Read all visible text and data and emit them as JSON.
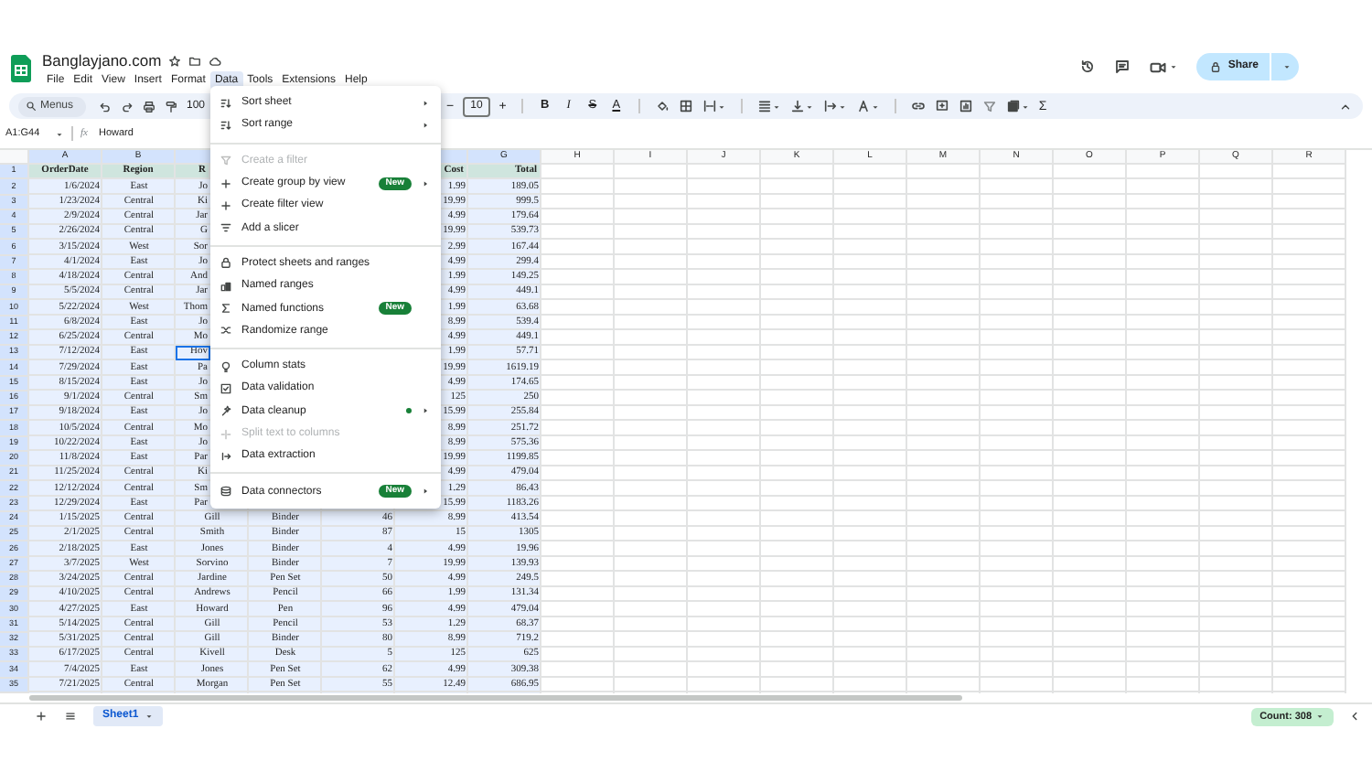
{
  "document": {
    "title": "Banglayjano.com"
  },
  "menubar": [
    {
      "label": "File",
      "selected": false
    },
    {
      "label": "Edit",
      "selected": false
    },
    {
      "label": "View",
      "selected": false
    },
    {
      "label": "Insert",
      "selected": false
    },
    {
      "label": "Format",
      "selected": false
    },
    {
      "label": "Data",
      "selected": true
    },
    {
      "label": "Tools",
      "selected": false
    },
    {
      "label": "Extensions",
      "selected": false
    },
    {
      "label": "Help",
      "selected": false
    }
  ],
  "share_button": {
    "label": "Share"
  },
  "toolbar": {
    "search_placeholder": "Menus",
    "zoom": "100",
    "font_size_minus": "−",
    "font_size": "10",
    "font_size_plus": "+",
    "style_buttons": [
      "B",
      "I",
      "S",
      "A"
    ],
    "sum": "Σ"
  },
  "formula_bar": {
    "name_box": "A1:G44",
    "fx": "fx",
    "value": "Howard"
  },
  "columns_left": [
    "A",
    "B"
  ],
  "columns_right": [
    "G",
    "H",
    "I",
    "J",
    "K",
    "L",
    "M",
    "N",
    "O",
    "P",
    "Q",
    "R"
  ],
  "rows": [
    {
      "number": "1",
      "kind": "header",
      "active": false,
      "order_date": "OrderDate",
      "region": "Region",
      "rep": "R",
      "cost": "Cost",
      "total": "Total"
    },
    {
      "number": "2",
      "kind": "data",
      "active": false,
      "order_date": "1/6/2024",
      "region": "East",
      "rep": "Jo",
      "cost": "1.99",
      "total": "189.05"
    },
    {
      "number": "3",
      "kind": "data",
      "active": false,
      "order_date": "1/23/2024",
      "region": "Central",
      "rep": "Ki",
      "cost": "19.99",
      "total": "999.5"
    },
    {
      "number": "4",
      "kind": "data",
      "active": false,
      "order_date": "2/9/2024",
      "region": "Central",
      "rep": "Jar",
      "cost": "4.99",
      "total": "179.64"
    },
    {
      "number": "5",
      "kind": "data",
      "active": false,
      "order_date": "2/26/2024",
      "region": "Central",
      "rep": "G",
      "cost": "19.99",
      "total": "539.73"
    },
    {
      "number": "6",
      "kind": "data",
      "active": false,
      "order_date": "3/15/2024",
      "region": "West",
      "rep": "Sor",
      "cost": "2.99",
      "total": "167.44"
    },
    {
      "number": "7",
      "kind": "data",
      "active": false,
      "order_date": "4/1/2024",
      "region": "East",
      "rep": "Jo",
      "cost": "4.99",
      "total": "299.4"
    },
    {
      "number": "8",
      "kind": "data",
      "active": false,
      "order_date": "4/18/2024",
      "region": "Central",
      "rep": "And",
      "cost": "1.99",
      "total": "149.25"
    },
    {
      "number": "9",
      "kind": "data",
      "active": false,
      "order_date": "5/5/2024",
      "region": "Central",
      "rep": "Jar",
      "cost": "4.99",
      "total": "449.1"
    },
    {
      "number": "10",
      "kind": "data",
      "active": false,
      "order_date": "5/22/2024",
      "region": "West",
      "rep": "Thom",
      "cost": "1.99",
      "total": "63.68"
    },
    {
      "number": "11",
      "kind": "data",
      "active": false,
      "order_date": "6/8/2024",
      "region": "East",
      "rep": "Jo",
      "cost": "8.99",
      "total": "539.4"
    },
    {
      "number": "12",
      "kind": "data",
      "active": false,
      "order_date": "6/25/2024",
      "region": "Central",
      "rep": "Mo",
      "cost": "4.99",
      "total": "449.1"
    },
    {
      "number": "13",
      "kind": "data",
      "active": true,
      "order_date": "7/12/2024",
      "region": "East",
      "rep": "Hov",
      "cost": "1.99",
      "total": "57.71"
    },
    {
      "number": "14",
      "kind": "data",
      "active": false,
      "order_date": "7/29/2024",
      "region": "East",
      "rep": "Pa",
      "cost": "19.99",
      "total": "1619.19"
    },
    {
      "number": "15",
      "kind": "data",
      "active": false,
      "order_date": "8/15/2024",
      "region": "East",
      "rep": "Jo",
      "cost": "4.99",
      "total": "174.65"
    },
    {
      "number": "16",
      "kind": "data",
      "active": false,
      "order_date": "9/1/2024",
      "region": "Central",
      "rep": "Sm",
      "cost": "125",
      "total": "250"
    },
    {
      "number": "17",
      "kind": "data",
      "active": false,
      "order_date": "9/18/2024",
      "region": "East",
      "rep": "Jo",
      "cost": "15.99",
      "total": "255.84"
    },
    {
      "number": "18",
      "kind": "data",
      "active": false,
      "order_date": "10/5/2024",
      "region": "Central",
      "rep": "Mo",
      "cost": "8.99",
      "total": "251.72"
    },
    {
      "number": "19",
      "kind": "data",
      "active": false,
      "order_date": "10/22/2024",
      "region": "East",
      "rep": "Jo",
      "cost": "8.99",
      "total": "575.36"
    },
    {
      "number": "20",
      "kind": "data",
      "active": false,
      "order_date": "11/8/2024",
      "region": "East",
      "rep": "Par",
      "cost": "19.99",
      "total": "1199.85"
    },
    {
      "number": "21",
      "kind": "data",
      "active": false,
      "order_date": "11/25/2024",
      "region": "Central",
      "rep": "Ki",
      "cost": "4.99",
      "total": "479.04"
    },
    {
      "number": "22",
      "kind": "data",
      "active": false,
      "order_date": "12/12/2024",
      "region": "Central",
      "rep": "Sm",
      "cost": "1.29",
      "total": "86.43"
    },
    {
      "number": "23",
      "kind": "data",
      "active": false,
      "order_date": "12/29/2024",
      "region": "East",
      "rep": "Par",
      "cost": "15.99",
      "total": "1183.26"
    },
    {
      "number": "24",
      "kind": "data",
      "active": false,
      "order_date": "1/15/2025",
      "region": "Central",
      "rep": "Gill",
      "item": "Binder",
      "units": "46",
      "cost": "8.99",
      "total": "413.54"
    },
    {
      "number": "25",
      "kind": "data",
      "active": false,
      "order_date": "2/1/2025",
      "region": "Central",
      "rep": "Smith",
      "item": "Binder",
      "units": "87",
      "cost": "15",
      "total": "1305"
    },
    {
      "number": "26",
      "kind": "data",
      "active": false,
      "order_date": "2/18/2025",
      "region": "East",
      "rep": "Jones",
      "item": "Binder",
      "units": "4",
      "cost": "4.99",
      "total": "19.96"
    },
    {
      "number": "27",
      "kind": "data",
      "active": false,
      "order_date": "3/7/2025",
      "region": "West",
      "rep": "Sorvino",
      "item": "Binder",
      "units": "7",
      "cost": "19.99",
      "total": "139.93"
    },
    {
      "number": "28",
      "kind": "data",
      "active": false,
      "order_date": "3/24/2025",
      "region": "Central",
      "rep": "Jardine",
      "item": "Pen Set",
      "units": "50",
      "cost": "4.99",
      "total": "249.5"
    },
    {
      "number": "29",
      "kind": "data",
      "active": false,
      "order_date": "4/10/2025",
      "region": "Central",
      "rep": "Andrews",
      "item": "Pencil",
      "units": "66",
      "cost": "1.99",
      "total": "131.34"
    },
    {
      "number": "30",
      "kind": "data",
      "active": false,
      "order_date": "4/27/2025",
      "region": "East",
      "rep": "Howard",
      "item": "Pen",
      "units": "96",
      "cost": "4.99",
      "total": "479.04"
    },
    {
      "number": "31",
      "kind": "data",
      "active": false,
      "order_date": "5/14/2025",
      "region": "Central",
      "rep": "Gill",
      "item": "Pencil",
      "units": "53",
      "cost": "1.29",
      "total": "68.37"
    },
    {
      "number": "32",
      "kind": "data",
      "active": false,
      "order_date": "5/31/2025",
      "region": "Central",
      "rep": "Gill",
      "item": "Binder",
      "units": "80",
      "cost": "8.99",
      "total": "719.2"
    },
    {
      "number": "33",
      "kind": "data",
      "active": false,
      "order_date": "6/17/2025",
      "region": "Central",
      "rep": "Kivell",
      "item": "Desk",
      "units": "5",
      "cost": "125",
      "total": "625"
    },
    {
      "number": "34",
      "kind": "data",
      "active": false,
      "order_date": "7/4/2025",
      "region": "East",
      "rep": "Jones",
      "item": "Pen Set",
      "units": "62",
      "cost": "4.99",
      "total": "309.38"
    },
    {
      "number": "35",
      "kind": "data",
      "active": false,
      "order_date": "7/21/2025",
      "region": "Central",
      "rep": "Morgan",
      "item": "Pen Set",
      "units": "55",
      "cost": "12.49",
      "total": "686.95"
    }
  ],
  "data_menu": {
    "groups": [
      [
        {
          "label": "Sort sheet",
          "disabled": false,
          "submenu": true,
          "dot": false
        },
        {
          "label": "Sort range",
          "disabled": false,
          "submenu": true,
          "dot": false
        }
      ],
      [
        {
          "label": "Create a filter",
          "disabled": true,
          "submenu": false,
          "dot": false
        },
        {
          "label": "Create group by view",
          "disabled": false,
          "submenu": true,
          "dot": false,
          "badge": "New"
        },
        {
          "label": "Create filter view",
          "disabled": false,
          "submenu": false,
          "dot": false
        },
        {
          "label": "Add a slicer",
          "disabled": false,
          "submenu": false,
          "dot": false
        }
      ],
      [
        {
          "label": "Protect sheets and ranges",
          "disabled": false,
          "submenu": false,
          "dot": false
        },
        {
          "label": "Named ranges",
          "disabled": false,
          "submenu": false,
          "dot": false
        },
        {
          "label": "Named functions",
          "disabled": false,
          "submenu": false,
          "dot": false,
          "badge": "New"
        },
        {
          "label": "Randomize range",
          "disabled": false,
          "submenu": false,
          "dot": false
        }
      ],
      [
        {
          "label": "Column stats",
          "disabled": false,
          "submenu": false,
          "dot": false
        },
        {
          "label": "Data validation",
          "disabled": false,
          "submenu": false,
          "dot": false
        },
        {
          "label": "Data cleanup",
          "disabled": false,
          "submenu": true,
          "dot": true
        },
        {
          "label": "Split text to columns",
          "disabled": true,
          "submenu": false,
          "dot": false
        },
        {
          "label": "Data extraction",
          "disabled": false,
          "submenu": false,
          "dot": false
        }
      ],
      [
        {
          "label": "Data connectors",
          "disabled": false,
          "submenu": true,
          "dot": false,
          "badge": "New"
        }
      ]
    ]
  },
  "sheet_tabs": [
    {
      "label": "Sheet1",
      "selected": true
    }
  ],
  "status": {
    "count": "Count: 308"
  }
}
